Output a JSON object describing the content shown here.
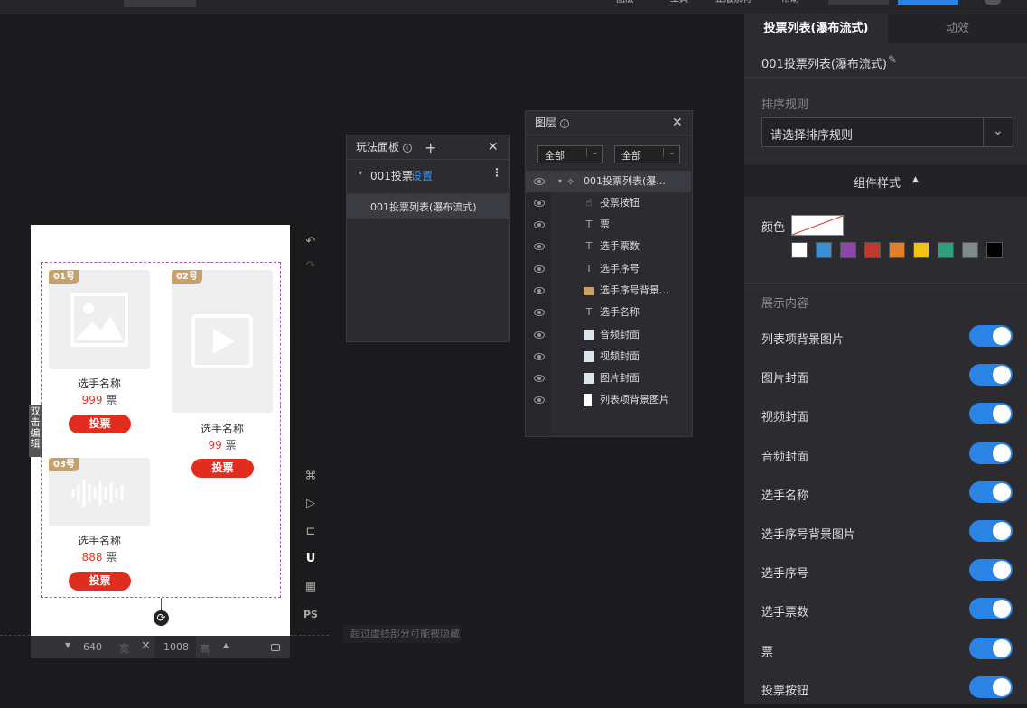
{
  "topbar": {
    "items": [
      "图层",
      "工具",
      "正版素材",
      "帮助"
    ]
  },
  "phone": {
    "side_tag": "双击编辑",
    "cards": [
      {
        "tag": "01号",
        "name": "选手名称",
        "votes": "999",
        "unit": "票",
        "button": "投票",
        "media": "image-icon"
      },
      {
        "tag": "02号",
        "name": "选手名称",
        "votes": "99",
        "unit": "票",
        "button": "投票",
        "media": "video-icon"
      },
      {
        "tag": "03号",
        "name": "选手名称",
        "votes": "888",
        "unit": "票",
        "button": "投票",
        "media": "audio-icon"
      }
    ],
    "width": "640",
    "width_unit": "宽",
    "height": "1008",
    "height_unit": "高",
    "hint": "超过虚线部分可能被隐藏"
  },
  "tools": {
    "ps_label": "PS"
  },
  "play_panel": {
    "title": "玩法面板",
    "group_name": "001投票",
    "group_link": "设置",
    "item": "001投票列表(瀑布流式)"
  },
  "layer_panel": {
    "title": "图层",
    "filter1": "全部",
    "filter2": "全部",
    "root": "001投票列表(瀑...",
    "items": [
      "投票按钮",
      "票",
      "选手票数",
      "选手序号",
      "选手序号背景...",
      "选手名称",
      "音频封面",
      "视频封面",
      "图片封面",
      "列表项背景图片"
    ]
  },
  "right_panel": {
    "tab_active": "投票列表(瀑布流式)",
    "tab_other": "动效",
    "component_name": "001投票列表(瀑布流式)",
    "sort_label": "排序规则",
    "sort_placeholder": "请选择排序规则",
    "style_header": "组件样式",
    "color_label": "颜色",
    "swatches": [
      "#ffffff",
      "#3b8ed8",
      "#8e44ad",
      "#c0392b",
      "#e67e22",
      "#f1c40f",
      "#2e9e7f",
      "#7f8c8d",
      "#000000"
    ],
    "show_label": "展示内容",
    "toggles": [
      "列表项背景图片",
      "图片封面",
      "视频封面",
      "音频封面",
      "选手名称",
      "选手序号背景图片",
      "选手序号",
      "选手票数",
      "票",
      "投票按钮"
    ]
  },
  "colors": {
    "accent": "#2a84e5",
    "vote_red": "#e02d20",
    "tag_gold": "#c8a06a"
  }
}
